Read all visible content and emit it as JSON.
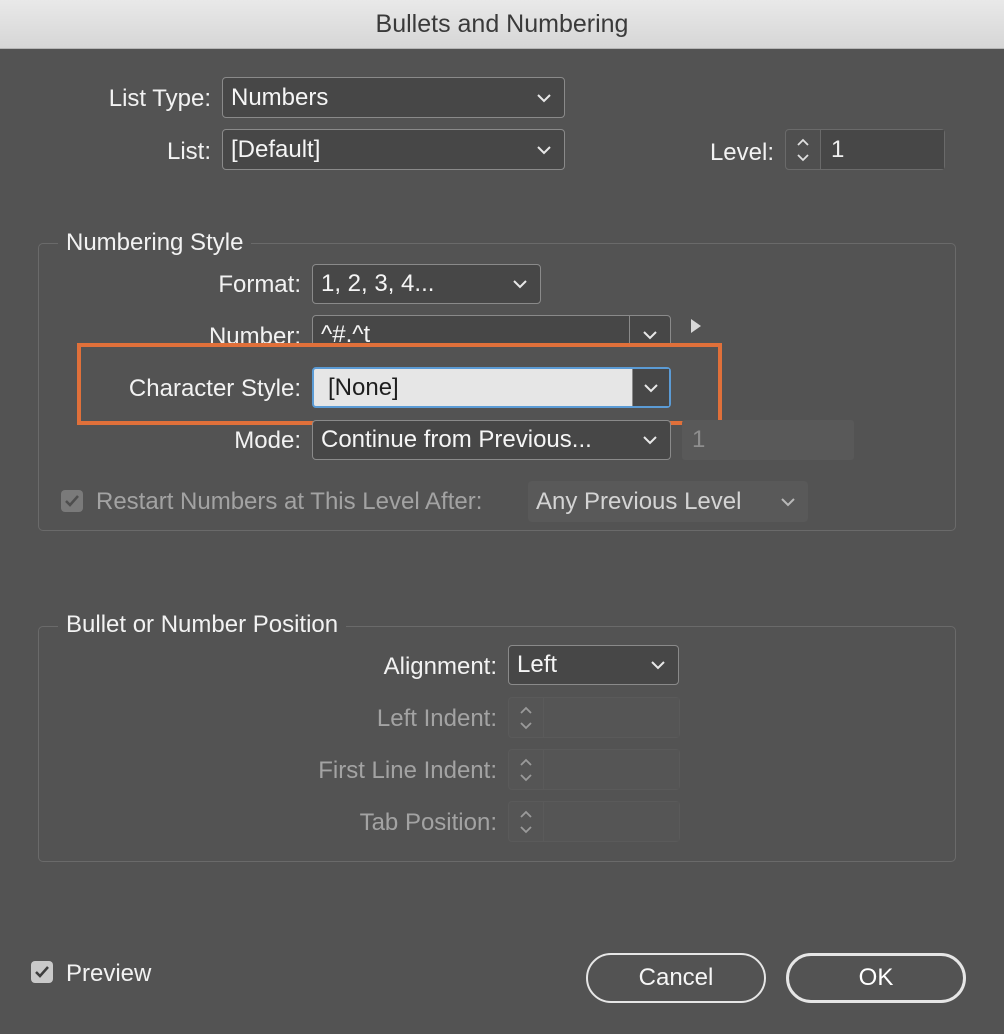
{
  "window": {
    "title": "Bullets and Numbering"
  },
  "top": {
    "list_type_label": "List Type:",
    "list_type_value": "Numbers",
    "list_label": "List:",
    "list_value": "[Default]",
    "level_label": "Level:",
    "level_value": "1"
  },
  "numbering_style": {
    "title": "Numbering Style",
    "format_label": "Format:",
    "format_value": "1, 2, 3, 4...",
    "number_label": "Number:",
    "number_value": "^#.^t",
    "character_style_label": "Character Style:",
    "character_style_value": "[None]",
    "mode_label": "Mode:",
    "mode_value": "Continue from Previous...",
    "mode_start_value": "1",
    "restart_label": "Restart Numbers at This Level After:",
    "restart_checked": true,
    "restart_value": "Any Previous Level"
  },
  "position": {
    "title": "Bullet or Number Position",
    "alignment_label": "Alignment:",
    "alignment_value": "Left",
    "left_indent_label": "Left Indent:",
    "left_indent_value": "",
    "first_line_indent_label": "First Line Indent:",
    "first_line_indent_value": "",
    "tab_position_label": "Tab Position:",
    "tab_position_value": ""
  },
  "footer": {
    "preview_label": "Preview",
    "preview_checked": true,
    "cancel_label": "Cancel",
    "ok_label": "OK"
  },
  "colors": {
    "dialog_bg": "#535353",
    "highlight": "#e0703a",
    "selected_field_bg": "#e6e6e6",
    "focus_ring": "#5b9bd5"
  }
}
